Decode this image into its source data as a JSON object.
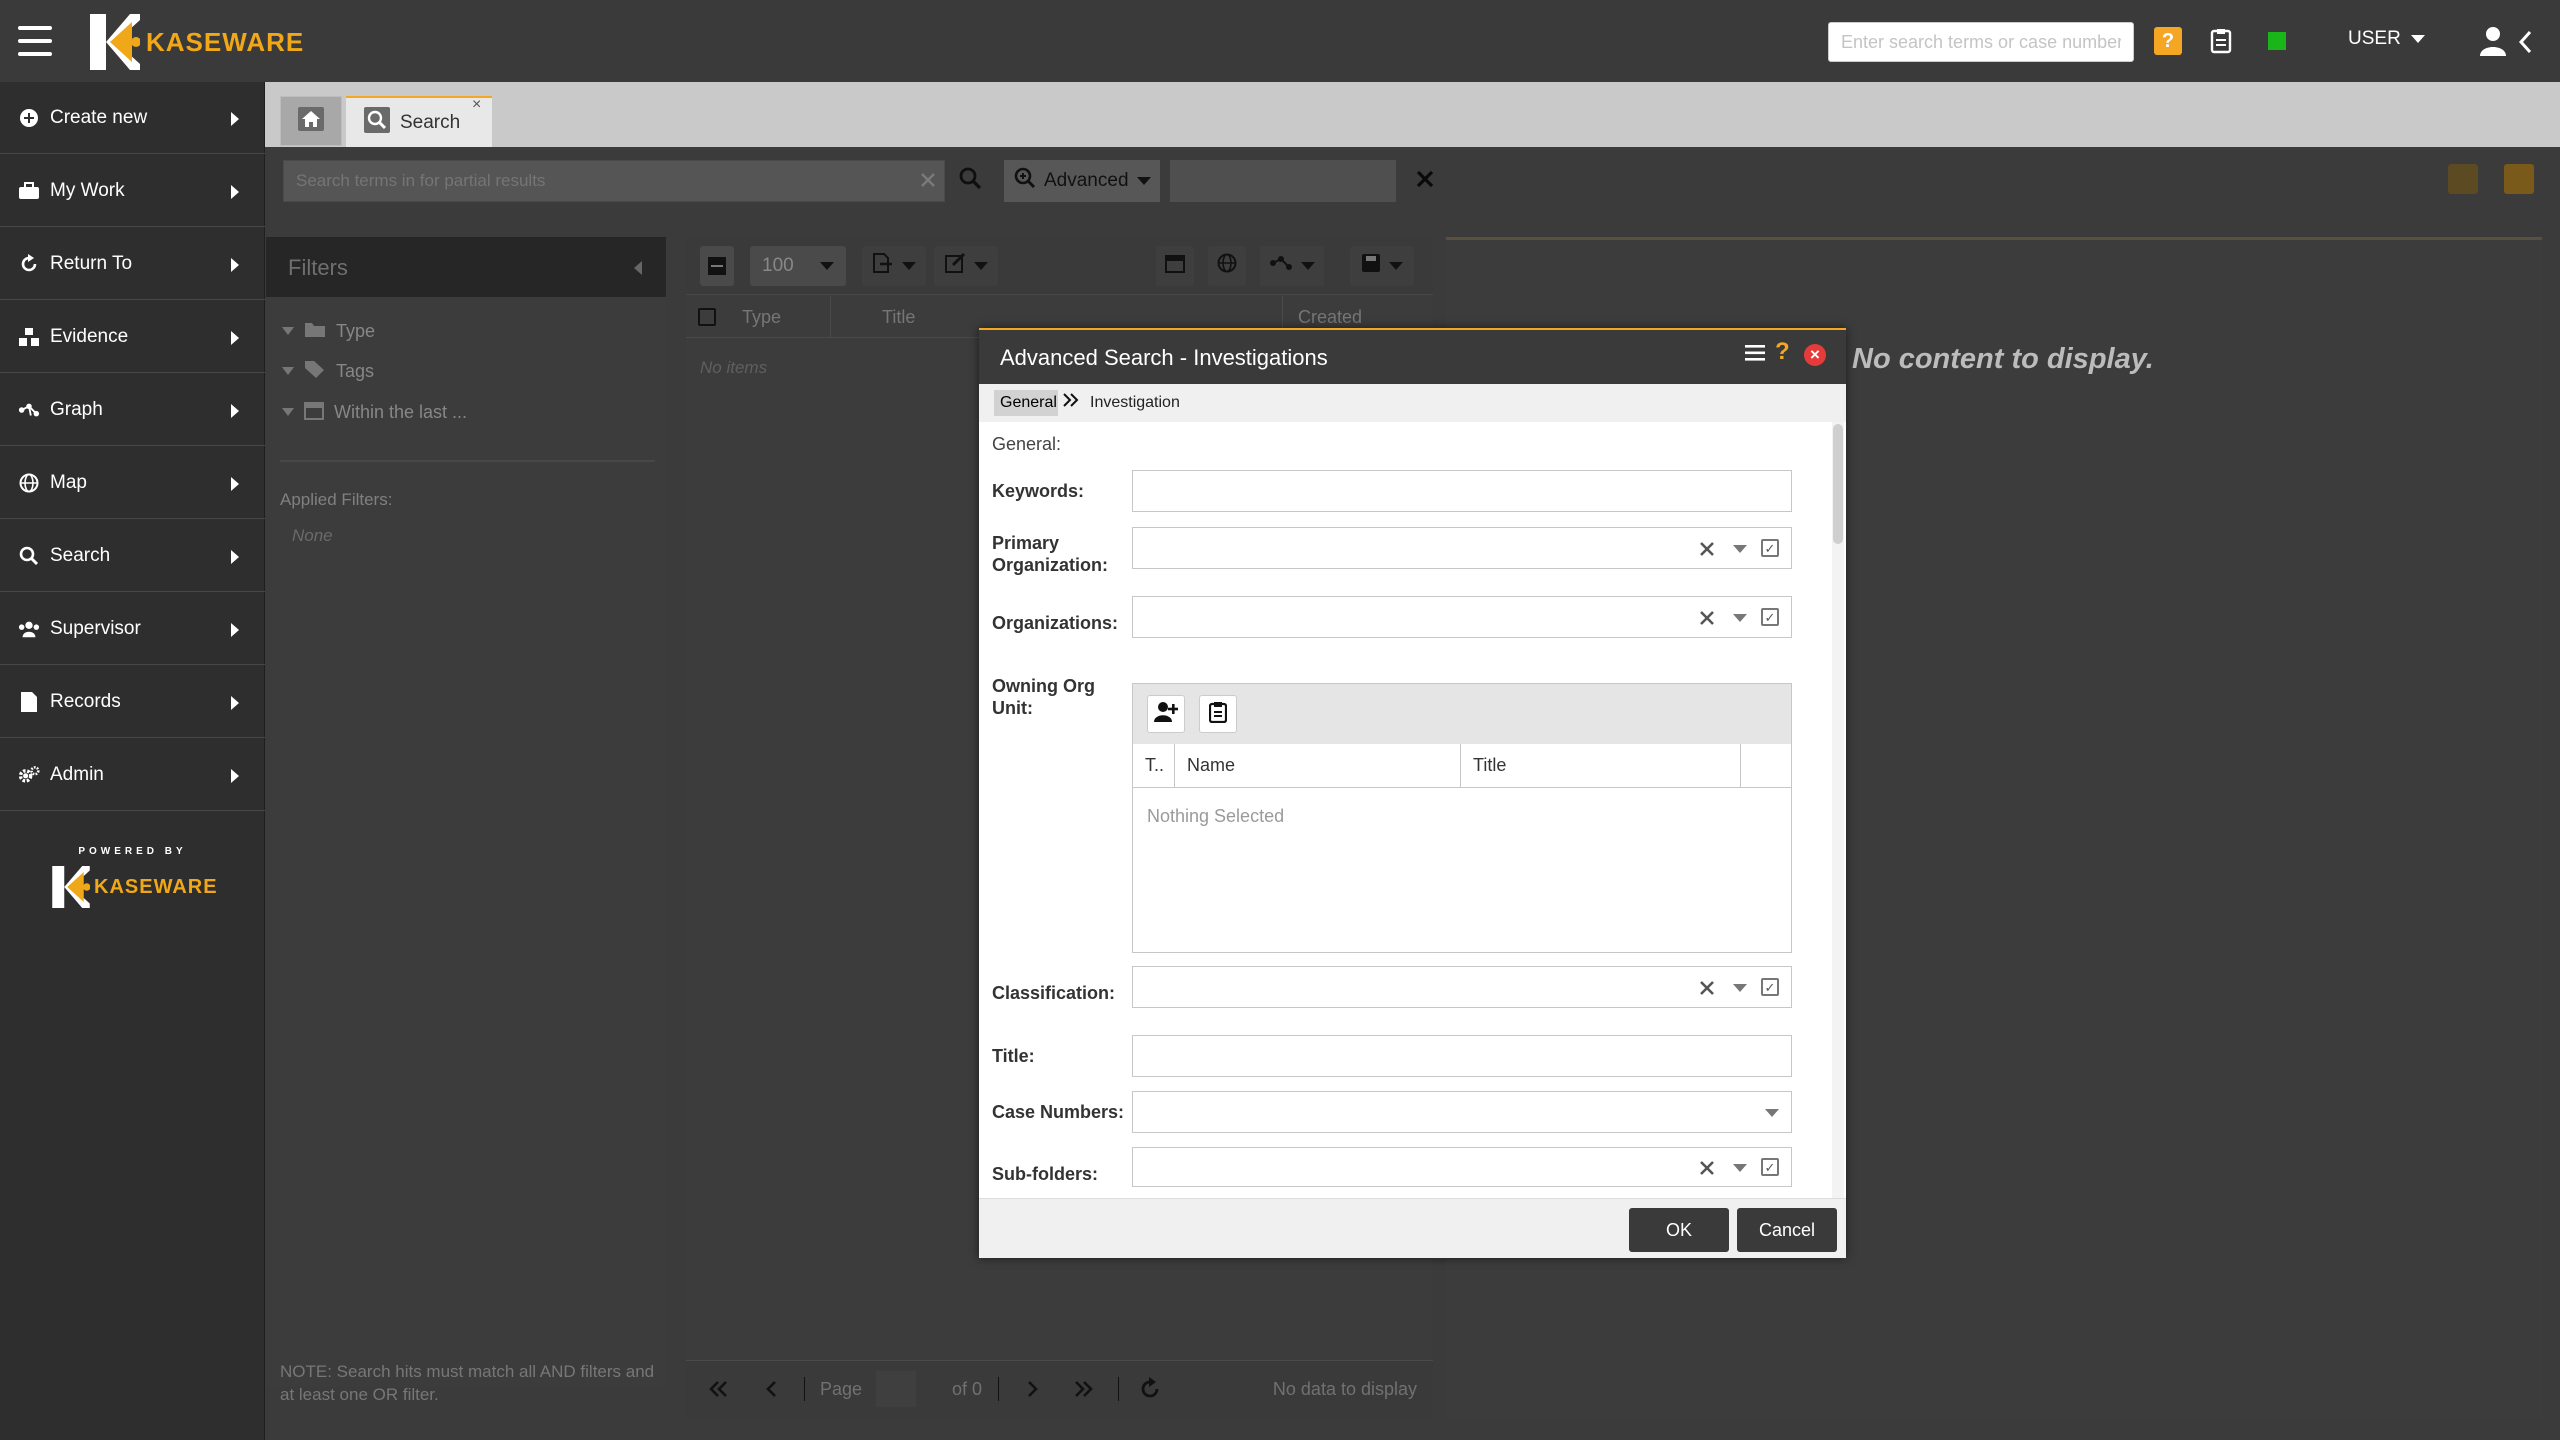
{
  "app": {
    "brand": "KASEWARE",
    "powered_by": "POWERED BY"
  },
  "header": {
    "search_placeholder": "Enter search terms or case number",
    "help": "?",
    "user_label": "USER"
  },
  "sidebar": {
    "items": [
      {
        "label": "Create new",
        "icon": "plus-circle-icon"
      },
      {
        "label": "My Work",
        "icon": "briefcase-icon"
      },
      {
        "label": "Return To",
        "icon": "refresh-icon"
      },
      {
        "label": "Evidence",
        "icon": "evidence-icon"
      },
      {
        "label": "Graph",
        "icon": "graph-icon"
      },
      {
        "label": "Map",
        "icon": "globe-icon"
      },
      {
        "label": "Search",
        "icon": "search-icon"
      },
      {
        "label": "Supervisor",
        "icon": "users-icon"
      },
      {
        "label": "Records",
        "icon": "document-icon"
      },
      {
        "label": "Admin",
        "icon": "gears-icon"
      }
    ]
  },
  "tabs": {
    "search_label": "Search",
    "close": "×"
  },
  "searchbar": {
    "placeholder": "Search terms in for partial results",
    "advanced_label": "Advanced"
  },
  "filters": {
    "title": "Filters",
    "items": [
      "Type",
      "Tags",
      "Within the last ..."
    ],
    "applied_label": "Applied Filters:",
    "applied_value": "None",
    "note": "NOTE: Search hits must match all AND filters and at least one OR filter."
  },
  "results": {
    "page_size": "100",
    "columns": [
      "Type",
      "Title",
      "Created"
    ],
    "empty": "No items",
    "pager": {
      "page_label": "Page",
      "of_label": "of 0",
      "status": "No data to display"
    }
  },
  "right_panel": {
    "empty": "No content to display."
  },
  "dialog": {
    "title": "Advanced Search - Investigations",
    "help": "?",
    "close": "×",
    "breadcrumbs": [
      "General",
      "Investigation"
    ],
    "section": "General:",
    "fields": {
      "keywords": "Keywords:",
      "primary_org_1": "Primary",
      "primary_org_2": "Organization:",
      "organizations": "Organizations:",
      "owning_1": "Owning Org",
      "owning_2": "Unit:",
      "classification": "Classification:",
      "title": "Title:",
      "case_numbers": "Case Numbers:",
      "sub_folders": "Sub-folders:"
    },
    "owning_table": {
      "columns": [
        "T..",
        "Name",
        "Title"
      ],
      "empty": "Nothing Selected"
    },
    "ok": "OK",
    "cancel": "Cancel"
  },
  "colors": {
    "accent": "#f5a623",
    "topbar": "#3a3a3a",
    "sidebar": "#2e2e2e",
    "status_green": "#19b519",
    "close_red": "#e63b3b"
  }
}
